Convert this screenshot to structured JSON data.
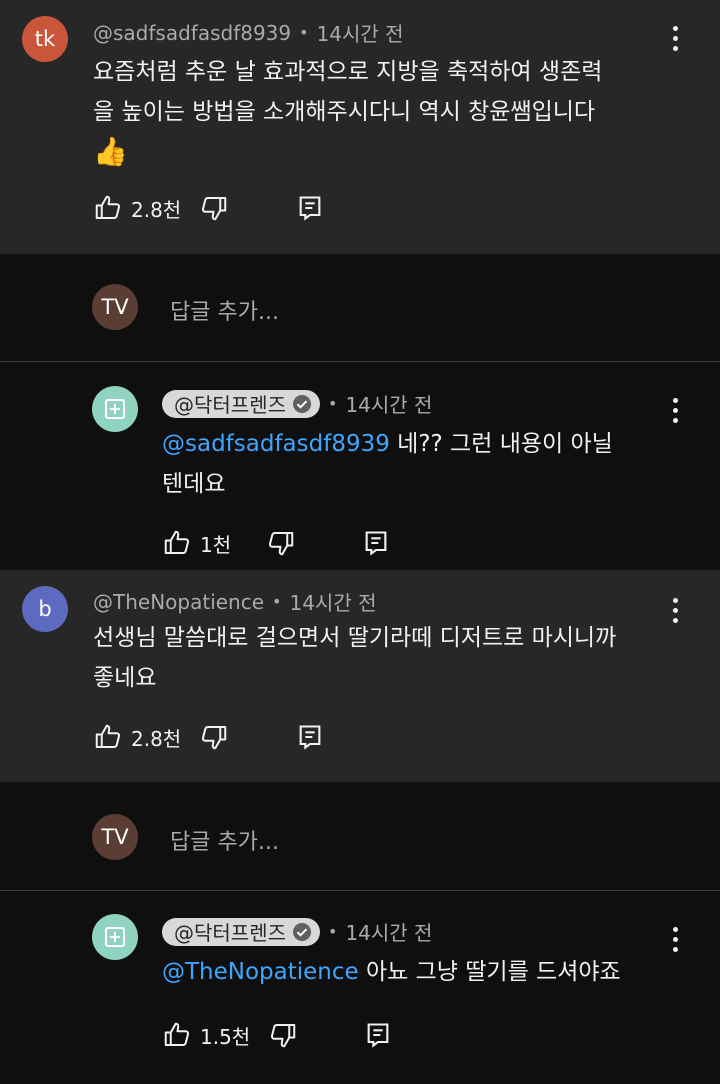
{
  "comments": [
    {
      "avatar": "tk",
      "avatar_color": "#c9563a",
      "author": "@sadfsadfasdf8939",
      "time": "14시간 전",
      "text_lines": [
        "요즘처럼 추운 날 효과적으로 지방을 축적하여 생존력",
        "을 높이는 방법을 소개해주시다니 역시 창윤쌤입니다"
      ],
      "emoji": "👍",
      "likes": "2.8천"
    },
    {
      "avatar": "b",
      "avatar_color": "#5c6bc0",
      "author": "@TheNopatience",
      "time": "14시간 전",
      "text_lines": [
        "선생님 말씀대로 걸으면서 딸기라떼 디저트로 마시니까",
        "좋네요"
      ],
      "likes": "2.8천"
    }
  ],
  "add_reply": {
    "avatar": "TV",
    "avatar_color": "#5a3e34",
    "placeholder": "답글 추가..."
  },
  "replies": [
    {
      "author": "@닥터프렌즈",
      "time": "14시간 전",
      "mention": "@sadfsadfasdf8939",
      "text_line1": " 네?? 그런 내용이 아닐",
      "text_line2": "텐데요",
      "likes": "1천",
      "avatar_color": "#8fd3c0"
    },
    {
      "author": "@닥터프렌즈",
      "time": "14시간 전",
      "mention": "@TheNopatience",
      "text_line1": " 아뇨 그냥 딸기를 드셔야죠",
      "likes": "1.5천",
      "avatar_color": "#8fd3c0"
    }
  ],
  "dot_separator": "•"
}
